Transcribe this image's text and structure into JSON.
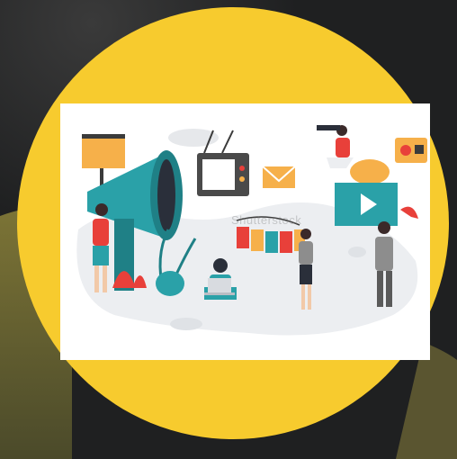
{
  "watermark": "Shutterstock",
  "colors": {
    "background": "#1f2021",
    "circle": "#f7cb2e",
    "card": "#ffffff",
    "teal": "#2aa1a8",
    "red": "#e8403a",
    "orange": "#f6b04a"
  },
  "icons": [
    "megaphone-icon",
    "tv-icon",
    "video-player-icon",
    "billboard-icon",
    "radio-icon",
    "envelope-icon",
    "laptop-icon"
  ]
}
